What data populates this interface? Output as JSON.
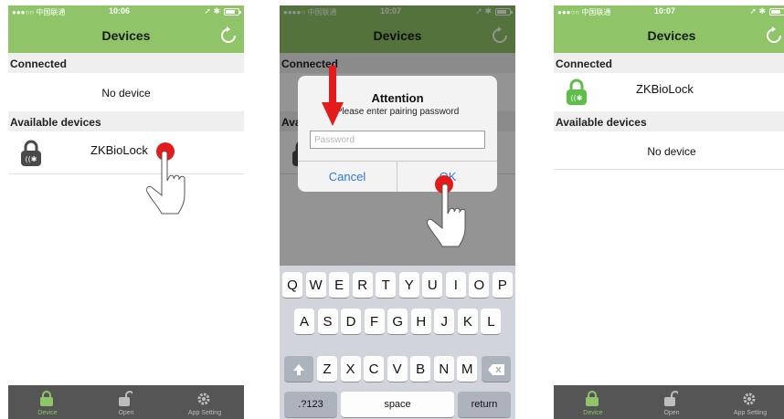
{
  "status": {
    "s1": {
      "carrier": "●●●○○ 中国联通",
      "time": "10:06"
    },
    "s2": {
      "carrier": "●●●●○ 中国联通",
      "time": "10:07"
    },
    "s3": {
      "carrier": "●●●○○ 中国联通",
      "time": "10:07"
    }
  },
  "nav": {
    "title": "Devices"
  },
  "sections": {
    "connected": "Connected",
    "available": "Available devices"
  },
  "list": {
    "no_device": "No device",
    "device_name": "ZKBioLock"
  },
  "tabs": [
    {
      "label": "Device",
      "icon": "lock-closed-icon"
    },
    {
      "label": "Open",
      "icon": "lock-open-icon"
    },
    {
      "label": "App Setting",
      "icon": "gear-icon"
    }
  ],
  "dialog": {
    "title": "Attention",
    "message": "Please enter pairing password",
    "placeholder": "Password",
    "cancel": "Cancel",
    "ok": "OK"
  },
  "keyboard": {
    "row1": [
      "Q",
      "W",
      "E",
      "R",
      "T",
      "Y",
      "U",
      "I",
      "O",
      "P"
    ],
    "row2": [
      "A",
      "S",
      "D",
      "F",
      "G",
      "H",
      "J",
      "K",
      "L"
    ],
    "row3": [
      "Z",
      "X",
      "C",
      "V",
      "B",
      "N",
      "M"
    ],
    "numbers": ".?123",
    "space": "space",
    "return": "return"
  },
  "colors": {
    "accent": "#8fc568",
    "tabbar": "#555555",
    "link": "#2b77e0",
    "arrow": "#e31b1b"
  }
}
